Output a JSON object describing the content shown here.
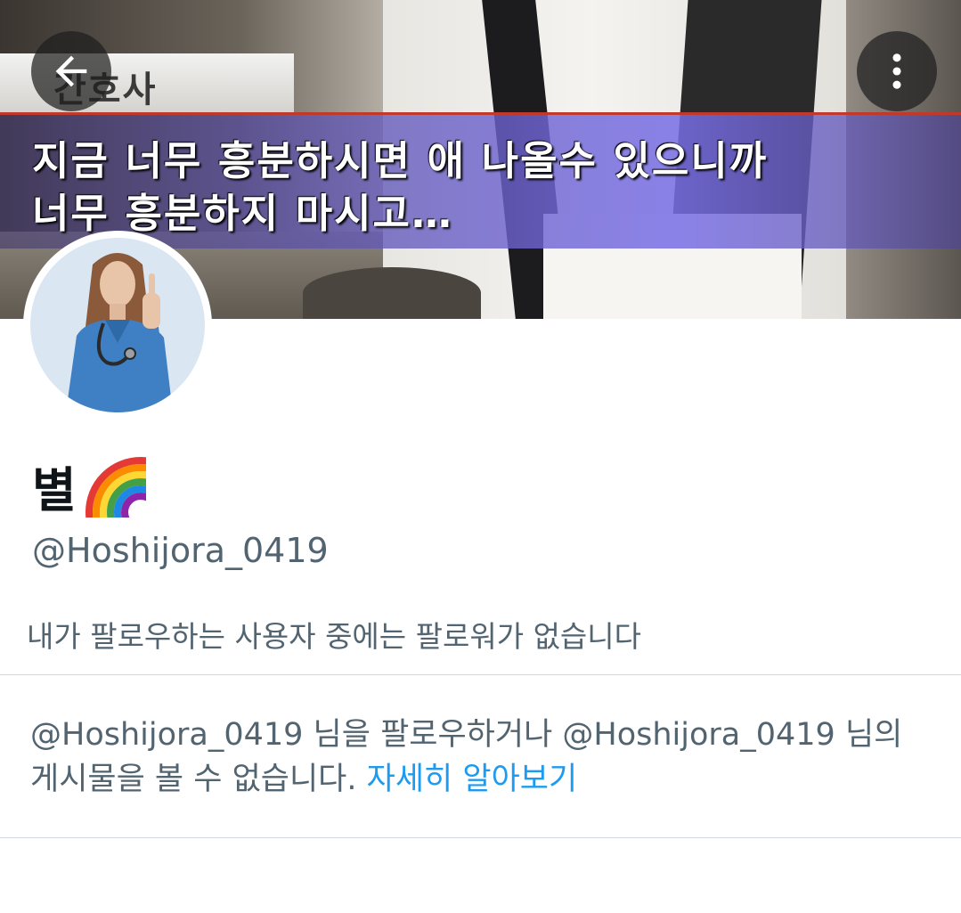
{
  "banner": {
    "caption_label": "간호사",
    "caption_line1": "지금 너무 흥분하시면 애 나올수 있으니까",
    "caption_line2": "너무 흥분하지 마시고…"
  },
  "nav": {
    "back_icon": "arrow-left-icon",
    "more_icon": "vertical-ellipsis-icon"
  },
  "profile": {
    "display_name": "별",
    "name_emoji": "🌈",
    "handle": "@Hoshijora_0419",
    "follow_note": "내가 팔로우하는 사용자 중에는 팔로워가 없습니다"
  },
  "protected_notice": {
    "line1": "@Hoshijora_0419 님을 팔로우하거나 @Hoshijora_0419 님의",
    "line2": "게시물을 볼 수 없습니다.",
    "learn_more": "자세히 알아보기"
  },
  "colors": {
    "accent": "#1d9bf0",
    "secondary_text": "#536471",
    "primary_text": "#0f1419",
    "divider": "#cfd9de"
  }
}
